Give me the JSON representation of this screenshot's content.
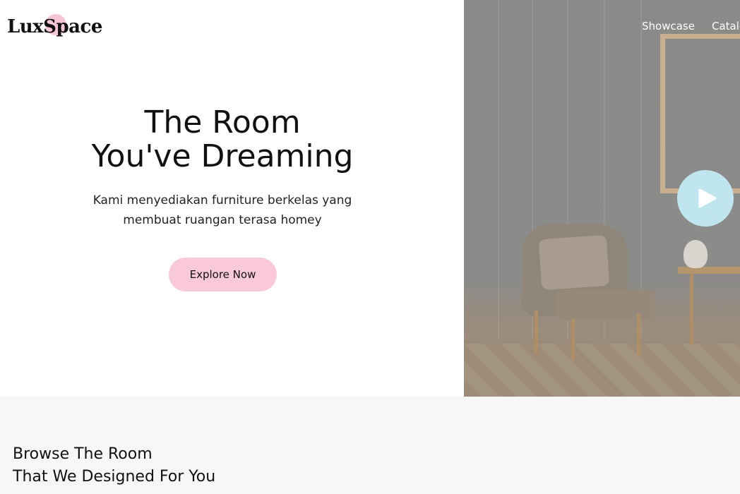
{
  "brand": {
    "logo_text": "LuxSpace"
  },
  "nav": {
    "items": [
      "Showcase",
      "Catalog"
    ]
  },
  "hero": {
    "title_line1": "The Room",
    "title_line2": "You've Dreaming",
    "subtitle_line1": "Kami menyediakan furniture berkelas yang",
    "subtitle_line2": "membuat ruangan terasa homey",
    "cta_label": "Explore Now"
  },
  "browse": {
    "title_line1": "Browse The Room",
    "title_line2": "That We Designed For You"
  },
  "colors": {
    "accent_pink": "#f9c9d9",
    "play_button": "#bfe6ef",
    "section_bg": "#f7f7f7"
  },
  "icons": {
    "play": "play-icon"
  }
}
